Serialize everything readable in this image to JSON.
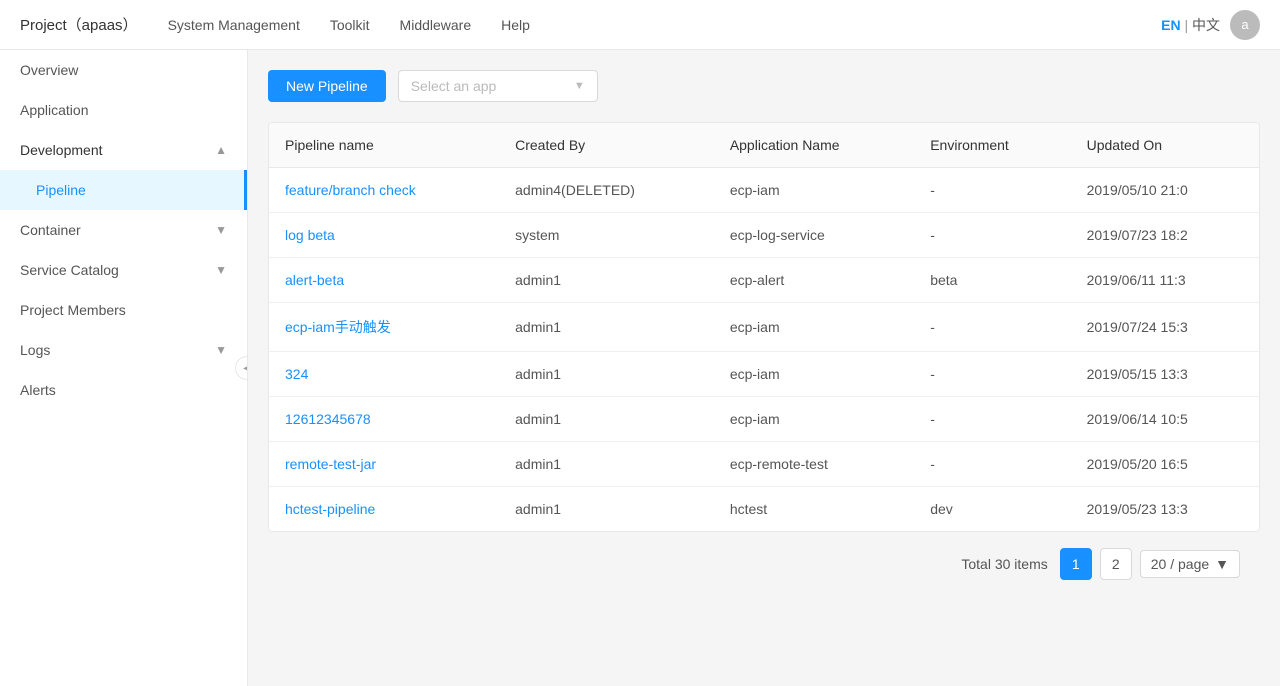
{
  "topNav": {
    "brand": "Project（apaas）",
    "items": [
      "System Management",
      "Toolkit",
      "Middleware",
      "Help"
    ],
    "lang": {
      "en": "EN",
      "sep": "|",
      "zh": "中文"
    },
    "avatarInitial": "a"
  },
  "sidebar": {
    "items": [
      {
        "id": "overview",
        "label": "Overview",
        "indent": 0,
        "active": false
      },
      {
        "id": "application",
        "label": "Application",
        "indent": 0,
        "active": false
      },
      {
        "id": "development",
        "label": "Development",
        "indent": 0,
        "active": false,
        "collapsible": true,
        "expanded": true
      },
      {
        "id": "pipeline",
        "label": "Pipeline",
        "indent": 1,
        "active": true
      },
      {
        "id": "container",
        "label": "Container",
        "indent": 0,
        "active": false,
        "collapsible": true
      },
      {
        "id": "service-catalog",
        "label": "Service Catalog",
        "indent": 0,
        "active": false,
        "collapsible": true
      },
      {
        "id": "project-members",
        "label": "Project Members",
        "indent": 0,
        "active": false
      },
      {
        "id": "logs",
        "label": "Logs",
        "indent": 0,
        "active": false,
        "collapsible": true
      },
      {
        "id": "alerts",
        "label": "Alerts",
        "indent": 0,
        "active": false
      }
    ]
  },
  "toolbar": {
    "newPipelineLabel": "New Pipeline",
    "selectAppPlaceholder": "Select an app"
  },
  "table": {
    "columns": [
      "Pipeline name",
      "Created By",
      "Application Name",
      "Environment",
      "Updated On"
    ],
    "rows": [
      {
        "pipelineName": "feature/branch check",
        "createdBy": "admin4(DELETED)",
        "appName": "ecp-iam",
        "environment": "-",
        "updatedOn": "2019/05/10 21:0"
      },
      {
        "pipelineName": "log beta",
        "createdBy": "system",
        "appName": "ecp-log-service",
        "environment": "-",
        "updatedOn": "2019/07/23 18:2"
      },
      {
        "pipelineName": "alert-beta",
        "createdBy": "admin1",
        "appName": "ecp-alert",
        "environment": "beta",
        "updatedOn": "2019/06/11 11:3"
      },
      {
        "pipelineName": "ecp-iam手动触发",
        "createdBy": "admin1",
        "appName": "ecp-iam",
        "environment": "-",
        "updatedOn": "2019/07/24 15:3"
      },
      {
        "pipelineName": "324",
        "createdBy": "admin1",
        "appName": "ecp-iam",
        "environment": "-",
        "updatedOn": "2019/05/15 13:3"
      },
      {
        "pipelineName": "12612345678",
        "createdBy": "admin1",
        "appName": "ecp-iam",
        "environment": "-",
        "updatedOn": "2019/06/14 10:5"
      },
      {
        "pipelineName": "remote-test-jar",
        "createdBy": "admin1",
        "appName": "ecp-remote-test",
        "environment": "-",
        "updatedOn": "2019/05/20 16:5"
      },
      {
        "pipelineName": "hctest-pipeline",
        "createdBy": "admin1",
        "appName": "hctest",
        "environment": "dev",
        "updatedOn": "2019/05/23 13:3"
      }
    ]
  },
  "pagination": {
    "totalText": "Total 30 items",
    "currentPage": 1,
    "pages": [
      1,
      2
    ],
    "pageSize": "20 / page"
  }
}
